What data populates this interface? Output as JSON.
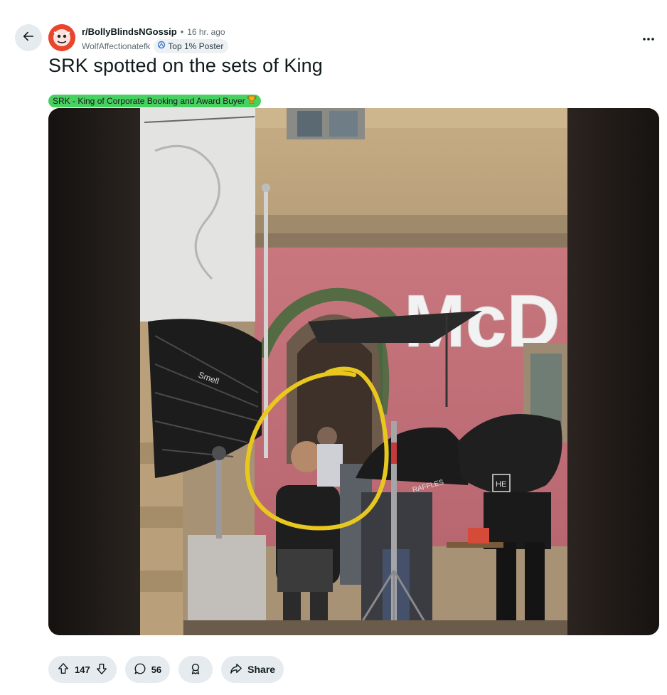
{
  "post": {
    "subreddit": "r/BollyBlindsNGossip",
    "separator": "•",
    "time": "16 hr. ago",
    "author": "WolfAffectionatefk",
    "author_badge": "Top 1% Poster",
    "title": "SRK spotted on the sets of King",
    "flair": "SRK - King of Corporate Booking and Award Buyer",
    "media_signs": {
      "store_sign": "McD",
      "umbrella_logo": "HE",
      "umbrella_brand": "RAFFLES",
      "reflector_brand": "Smell"
    }
  },
  "actions": {
    "upvotes": "147",
    "comments": "56",
    "share_label": "Share"
  },
  "icons": {
    "back": "back-arrow-icon",
    "more": "more-horizontal-icon",
    "badge": "top-poster-icon",
    "flair_emoji": "trophy-icon",
    "upvote": "upvote-arrow-icon",
    "downvote": "downvote-arrow-icon",
    "comment": "comment-bubble-icon",
    "award": "award-icon",
    "share": "share-arrow-icon"
  },
  "colors": {
    "flair_bg": "#46d160",
    "action_bg": "#e5ebee",
    "avatar_bg": "#e8452c",
    "highlight_circle": "#e8c81e"
  }
}
